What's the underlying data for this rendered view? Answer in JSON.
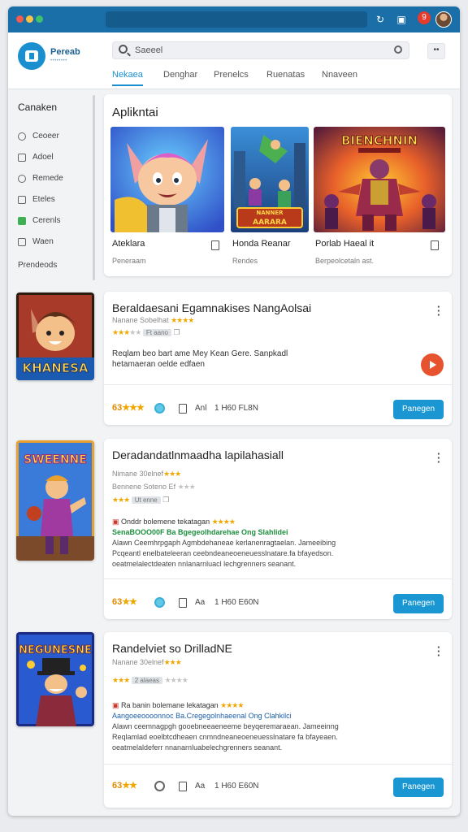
{
  "titlebar": {
    "badge": "9"
  },
  "header": {
    "brand": "Pereab",
    "brand_sub": "••••••••",
    "search_placeholder": "Saeeel",
    "menu_label": "••",
    "tabs": [
      "Nekaea",
      "Denghar",
      "Prenelcs",
      "Ruenatas",
      "Nnaveen"
    ]
  },
  "sidebar": {
    "title": "Canaken",
    "items": [
      {
        "label": "Ceoeer"
      },
      {
        "label": "Adoel"
      },
      {
        "label": "Remede"
      },
      {
        "label": "Eteles"
      },
      {
        "label": "Cerenls"
      },
      {
        "label": "Waen"
      }
    ],
    "footer": "Prendeods"
  },
  "featured": {
    "title": "Aplikntai",
    "items": [
      {
        "name": "Ateklara",
        "sub": "Peneraam"
      },
      {
        "name": "Honda Reanar",
        "sub": "Rendes"
      },
      {
        "name": "Porlab Haeal it",
        "sub": "Berpeolcetaln ast."
      }
    ],
    "banner_texts": [
      "NANNER",
      "AARARA",
      "BIENCHNIN",
      "KHANESA"
    ]
  },
  "rows": [
    {
      "icon_text": "KHANESA",
      "title": "Beraldaesani Egamnakises NangAolsai",
      "meta1": "Nanane Sobelhat",
      "meta1_stars": "★★★★",
      "meta2_stars": "★★★",
      "meta2_gstars": "★★",
      "meta2_chip": "Ft aano",
      "desc_lines": [
        "Reqlam beo bart ame Mey Kean Gere. Sanpkadl",
        "hetamaeran oelde edfaen"
      ],
      "rating": "63",
      "rating_stars": "★★★",
      "foot_text": "Anl",
      "foot_count": "1 H60 FL8N",
      "button": "Panegen"
    },
    {
      "icon_text": "SWEENNE",
      "title": "Deradandatlnmaadha lapilahasiall",
      "meta1": "Nimane 30elnef",
      "meta1_stars": "★★★",
      "meta2": "Bennene Soteno  Ef",
      "meta2_gstars": "★★★",
      "meta3_stars": "★★★",
      "meta3_chip": "Ut enne",
      "hl_line": "Onddr bolemene tekatagan",
      "hl_line_stars": "★★★★",
      "hl2_line": "SenaBOOO00F Ba Bgegeolhdarehae Ong Slahlidei",
      "desc_lines": [
        "Alawn  Ceemhrpgaph Agmbdehaneae kerlanenragtaelan. Jameeibing",
        "Pcqeantl enelbateleeran ceebndeaneoeneuesslnatare.fa bfayedson.",
        "oeatmelalectdeaten nnlanarnluacl lechgrenners seanant."
      ],
      "rating": "63",
      "rating_stars": "★★",
      "foot_text": "Aa",
      "foot_count": "1 H60 E60N",
      "button": "Panegen"
    },
    {
      "icon_text": "NEGUNESNE",
      "title": "Randelviet so DrilladNE",
      "meta1": "Nanane 30elnef",
      "meta1_stars": "★★★",
      "meta2_stars": "★★★",
      "meta2_chip": "2 alaeas",
      "meta2_gstars": "★★★★",
      "hl_line": "Ra banin bolemane lekatagan",
      "hl_line_stars": "★★★★",
      "hl3_line": "Aangoeeoooonnoc Ba.Cregegolnhaeenal Ong Clahkilci",
      "desc_lines": [
        "Alawn  ceemnagpgh gooebneeaeneeme beyqeremaraean. Jameeinng",
        "Reqlamlad eoelbtcdheaen cnmndneaneoeneuesslnatare fa bfayeaen.",
        "oeatmelaldeferr nnanarnluabelechgrenners seanant."
      ],
      "rating": "63",
      "rating_stars": "★★",
      "foot_text": "Aa",
      "foot_count": "1 H60 E60N",
      "button": "Panegen"
    }
  ],
  "colors": {
    "accent": "#1a96d2",
    "titlebar": "#1b6fa8",
    "star": "#f0a800",
    "play": "#e8532f"
  }
}
